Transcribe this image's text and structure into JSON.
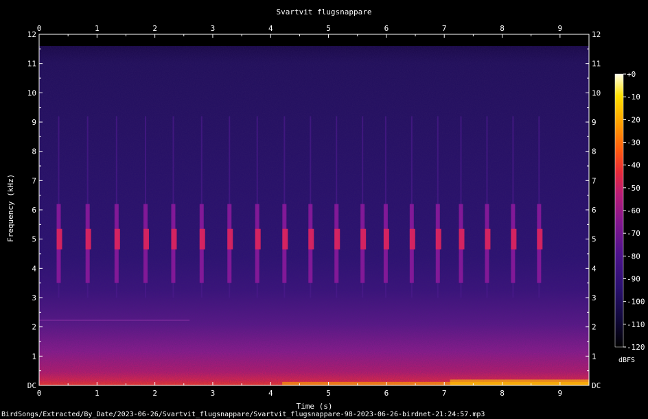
{
  "chart_data": {
    "type": "heatmap",
    "title": "Svartvit flugsnappare",
    "xlabel": "Time (s)",
    "ylabel": "Frequency (kHz)",
    "xlim": [
      0,
      9.5
    ],
    "ylim": [
      0,
      12
    ],
    "x_ticks": [
      "0",
      "1",
      "2",
      "3",
      "4",
      "5",
      "6",
      "7",
      "8",
      "9"
    ],
    "y_ticks": [
      "DC",
      "1",
      "2",
      "3",
      "4",
      "5",
      "6",
      "7",
      "8",
      "9",
      "10",
      "11",
      "12"
    ],
    "colorbar": {
      "label": "dBFS",
      "range": [
        -120,
        0
      ],
      "ticks": [
        "+0",
        "-10",
        "-20",
        "-30",
        "-40",
        "-50",
        "-60",
        "-70",
        "-80",
        "-90",
        "-100",
        "-110",
        "-120"
      ],
      "colors": [
        "#000000",
        "#1a0a55",
        "#4d0f8c",
        "#8a1a8a",
        "#c8206a",
        "#ee2a2a",
        "#ff6a00",
        "#ffb300",
        "#ffe600",
        "#ffffe0"
      ]
    },
    "call_times": [
      0.35,
      0.85,
      1.35,
      1.85,
      2.33,
      2.82,
      3.3,
      3.78,
      4.25,
      4.7,
      5.15,
      5.6,
      6.0,
      6.45,
      6.9,
      7.3,
      7.75,
      8.2,
      8.65
    ],
    "call_freq_khz": [
      3.5,
      6.2
    ],
    "call_peak_khz": 5.0
  },
  "footer": "BirdSongs/Extracted/By_Date/2023-06-26/Svartvit_flugsnappare/Svartvit_flugsnappare-98-2023-06-26-birdnet-21:24:57.mp3"
}
